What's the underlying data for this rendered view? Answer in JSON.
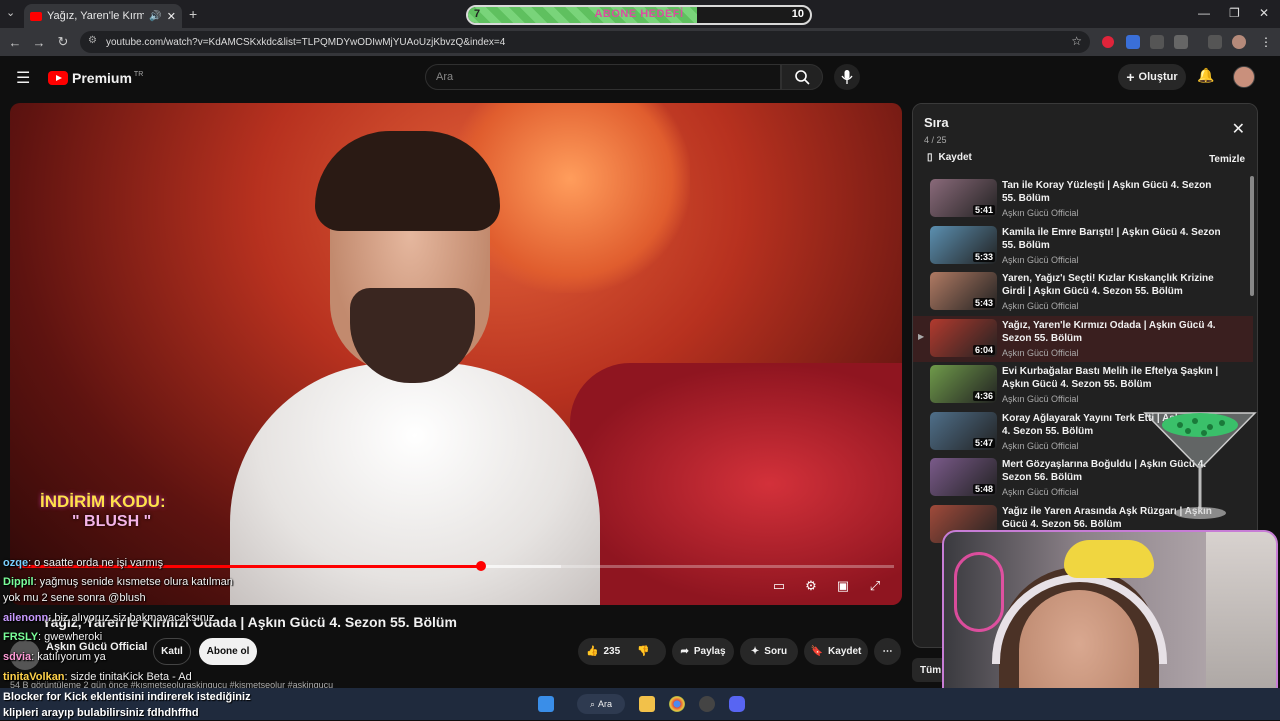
{
  "browser": {
    "tab_title": "Yağız, Yaren'le Kırmızı Odada",
    "url": "youtube.com/watch?v=KdAMCSKxkdc&list=TLPQMDYwODIwMjYUAoUzjKbvzQ&index=4",
    "new_tab": "+",
    "back": "←",
    "forward": "→",
    "reload": "↻"
  },
  "goal_bar": {
    "label": "ABONE HEDEFİ",
    "start": "7",
    "end": "10",
    "progress": 0.67
  },
  "youtube": {
    "logo": "Premium",
    "region": "TR",
    "search_placeholder": "Ara",
    "create_label": "Oluştur"
  },
  "video": {
    "promo_line1": "İNDİRİM KODU:",
    "promo_line2": "\" BLUSH \"",
    "progress": 0.528,
    "buffered_start": 0.528,
    "buffered_end": 0.62
  },
  "watch": {
    "title": "Yağız, Yaren'le Kırmızı Odada | Aşkın Gücü 4. Sezon 55. Bölüm",
    "channel": "Aşkın Gücü Official",
    "join_label": "Katıl",
    "subscribe_label": "Abone ol",
    "likes": "235",
    "share_label": "Paylaş",
    "ask_label": "Soru",
    "save_label": "Kaydet",
    "description_snippet": "54 B görüntüleme  2 gün önce  #kısmetseoluraskingucu #kismetseolur #askingucu"
  },
  "queue": {
    "title": "Sıra",
    "count": "4 / 25",
    "save_label": "Kaydet",
    "clear_label": "Temizle",
    "items": [
      {
        "title": "Tan ile Koray Yüzleşti | Aşkın Gücü 4. Sezon 55. Bölüm",
        "channel": "Aşkın Gücü Official",
        "duration": "5:41",
        "color": "#8a6a7a"
      },
      {
        "title": "Kamila ile Emre Barıştı! | Aşkın Gücü 4. Sezon 55. Bölüm",
        "channel": "Aşkın Gücü Official",
        "duration": "5:33",
        "color": "#5b8fb0"
      },
      {
        "title": "Yaren, Yağız'ı Seçti! Kızlar Kıskançlık Krizine Girdi | Aşkın Gücü 4. Sezon 55. Bölüm",
        "channel": "Aşkın Gücü Official",
        "duration": "5:43",
        "color": "#b07a63"
      },
      {
        "title": "Yağız, Yaren'le Kırmızı Odada | Aşkın Gücü 4. Sezon 55. Bölüm",
        "channel": "Aşkın Gücü Official",
        "duration": "6:04",
        "color": "#b23a2e"
      },
      {
        "title": "Evi Kurbağalar Bastı Melih ile Eftelya Şaşkın | Aşkın Gücü 4. Sezon 55. Bölüm",
        "channel": "Aşkın Gücü Official",
        "duration": "4:36",
        "color": "#6f9a4a"
      },
      {
        "title": "Koray Ağlayarak Yayını Terk Etti | Aşkın Gücü 4. Sezon 55. Bölüm",
        "channel": "Aşkın Gücü Official",
        "duration": "5:47",
        "color": "#4f6f8a"
      },
      {
        "title": "Mert Gözyaşlarına Boğuldu | Aşkın Gücü 4. Sezon 56. Bölüm",
        "channel": "Aşkın Gücü Official",
        "duration": "5:48",
        "color": "#7a5a8a"
      },
      {
        "title": "Yağız ile Yaren Arasında Aşk Rüzgarı | Aşkın Gücü 4. Sezon 56. Bölüm",
        "channel": "",
        "duration": "",
        "color": "#a04a3a"
      }
    ]
  },
  "chat": [
    {
      "user": "ozqe",
      "msg": ": o saatte orda ne işi varmış",
      "color": "#7ad0ff"
    },
    {
      "user": "Dippil",
      "msg": ": yağmuş senide kısmetse olura katılman",
      "color": "#7aff9a"
    },
    {
      "user": "",
      "msg": "yok mu 2 sene sonra @blush",
      "color": "#ffffff"
    },
    {
      "user": "ailenonn",
      "msg": ": biz alıyoruz siz bakmayacaksınız",
      "color": "#c89bff"
    },
    {
      "user": "FRSLY",
      "msg": ": gwewheroki",
      "color": "#7aff9a"
    },
    {
      "user": "sdvia",
      "msg": ": katılıyorum ya",
      "color": "#ff9bd6"
    },
    {
      "user": "tinitaVolkan",
      "msg": ": sizde tinitaKick Beta - Ad",
      "color": "#ffd24a"
    }
  ],
  "bottom_text": [
    "Blocker for Kick eklentisini indirerek istediğiniz",
    "klipleri arayıp bulabilirsiniz fdhdhffhd"
  ],
  "partial_chip": "Tüm",
  "taskbar": {
    "search_label": "Ara"
  },
  "colors": {
    "accent": "#ff0000",
    "queue_active": "#3a1f1f"
  }
}
